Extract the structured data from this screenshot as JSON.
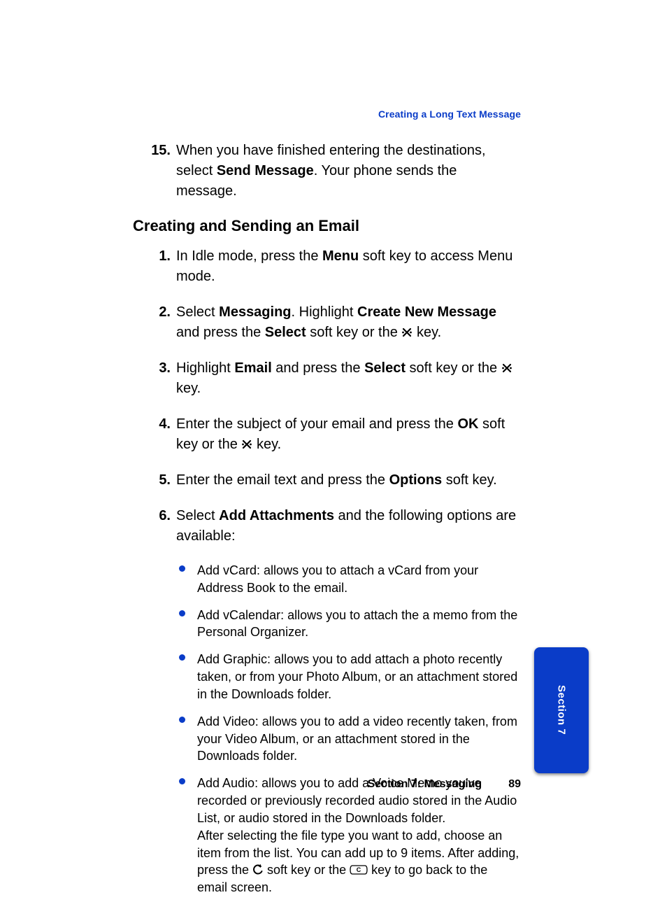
{
  "running_head": "Creating a Long Text Message",
  "step15": {
    "num": "15.",
    "text_before": "When you have finished entering the destinations, select ",
    "bold1": "Send Message",
    "text_after": ". Your phone sends the message."
  },
  "heading": "Creating and Sending an Email",
  "steps": [
    {
      "num": "1.",
      "parts": [
        {
          "t": "In Idle mode, press the "
        },
        {
          "b": "Menu"
        },
        {
          "t": " soft key to access Menu mode."
        }
      ]
    },
    {
      "num": "2.",
      "parts": [
        {
          "t": "Select "
        },
        {
          "b": "Messaging"
        },
        {
          "t": ". Highlight "
        },
        {
          "b": "Create New Message"
        },
        {
          "t": " and press the "
        },
        {
          "b": "Select"
        },
        {
          "t": " soft key or the "
        },
        {
          "icon": "x"
        },
        {
          "t": " key."
        }
      ]
    },
    {
      "num": "3.",
      "parts": [
        {
          "t": "Highlight "
        },
        {
          "b": "Email"
        },
        {
          "t": " and press the "
        },
        {
          "b": "Select"
        },
        {
          "t": " soft key or the "
        },
        {
          "icon": "x"
        },
        {
          "t": " key."
        }
      ]
    },
    {
      "num": "4.",
      "parts": [
        {
          "t": "Enter the subject of your email and press the "
        },
        {
          "b": "OK"
        },
        {
          "t": " soft key or the "
        },
        {
          "icon": "x"
        },
        {
          "t": " key."
        }
      ]
    },
    {
      "num": "5.",
      "parts": [
        {
          "t": "Enter the email text and press the "
        },
        {
          "b": "Options"
        },
        {
          "t": " soft key."
        }
      ]
    },
    {
      "num": "6.",
      "parts": [
        {
          "t": "Select "
        },
        {
          "b": "Add Attachments"
        },
        {
          "t": " and the following options are available:"
        }
      ]
    }
  ],
  "bullets": [
    "Add vCard: allows you to attach a vCard from your Address Book to the email.",
    "Add vCalendar: allows you to attach the a memo from the Personal Organizer.",
    "Add Graphic: allows you to add attach a photo recently taken, or from your Photo Album, or an attachment stored in the Downloads folder.",
    "Add Video: allows you to add a video recently taken, from your Video Album, or an attachment stored in the Downloads folder."
  ],
  "last_bullet": {
    "line1": "Add Audio: allows you to add a Voice Memo you've recorded or previously recorded audio stored in the Audio List, or audio stored in the Downloads folder.",
    "line2_before": "After selecting the file type you want to add, choose an item from the list. You can add up to 9 items. After adding, press the ",
    "line2_mid": " soft key or the ",
    "line2_after": " key to go back to the email screen."
  },
  "footer_section": "Section 7: Messaging",
  "footer_page": "89",
  "tab_label": "Section 7"
}
